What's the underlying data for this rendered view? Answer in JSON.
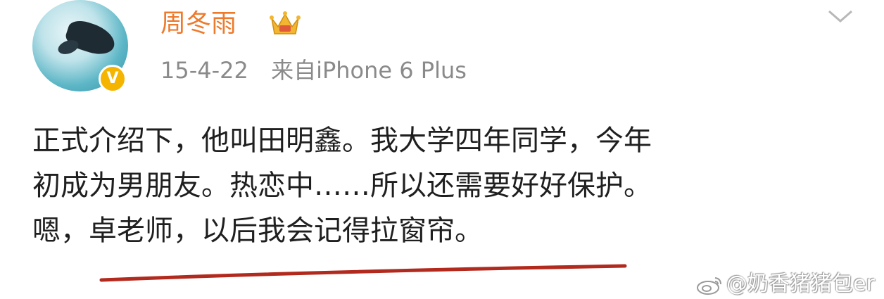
{
  "post": {
    "author": "周冬雨",
    "date": "15-4-22",
    "source": "来自iPhone 6 Plus",
    "lines": [
      "正式介绍下，他叫田明鑫。我大学四年同学，今年",
      "初成为男朋友。热恋中……所以还需要好好保护。",
      "嗯，卓老师，以后我会记得拉窗帘。"
    ]
  },
  "icons": {
    "verified_badge": "verified-v-icon",
    "member_crown": "crown-icon",
    "menu": "chevron-down-icon"
  },
  "watermark": "@奶香猪猪包er",
  "colors": {
    "author": "#ee7a2b",
    "meta": "#8a8a8a",
    "text": "#1f1f1f",
    "underline": "#b22a1e",
    "badge": "#f5b400"
  }
}
